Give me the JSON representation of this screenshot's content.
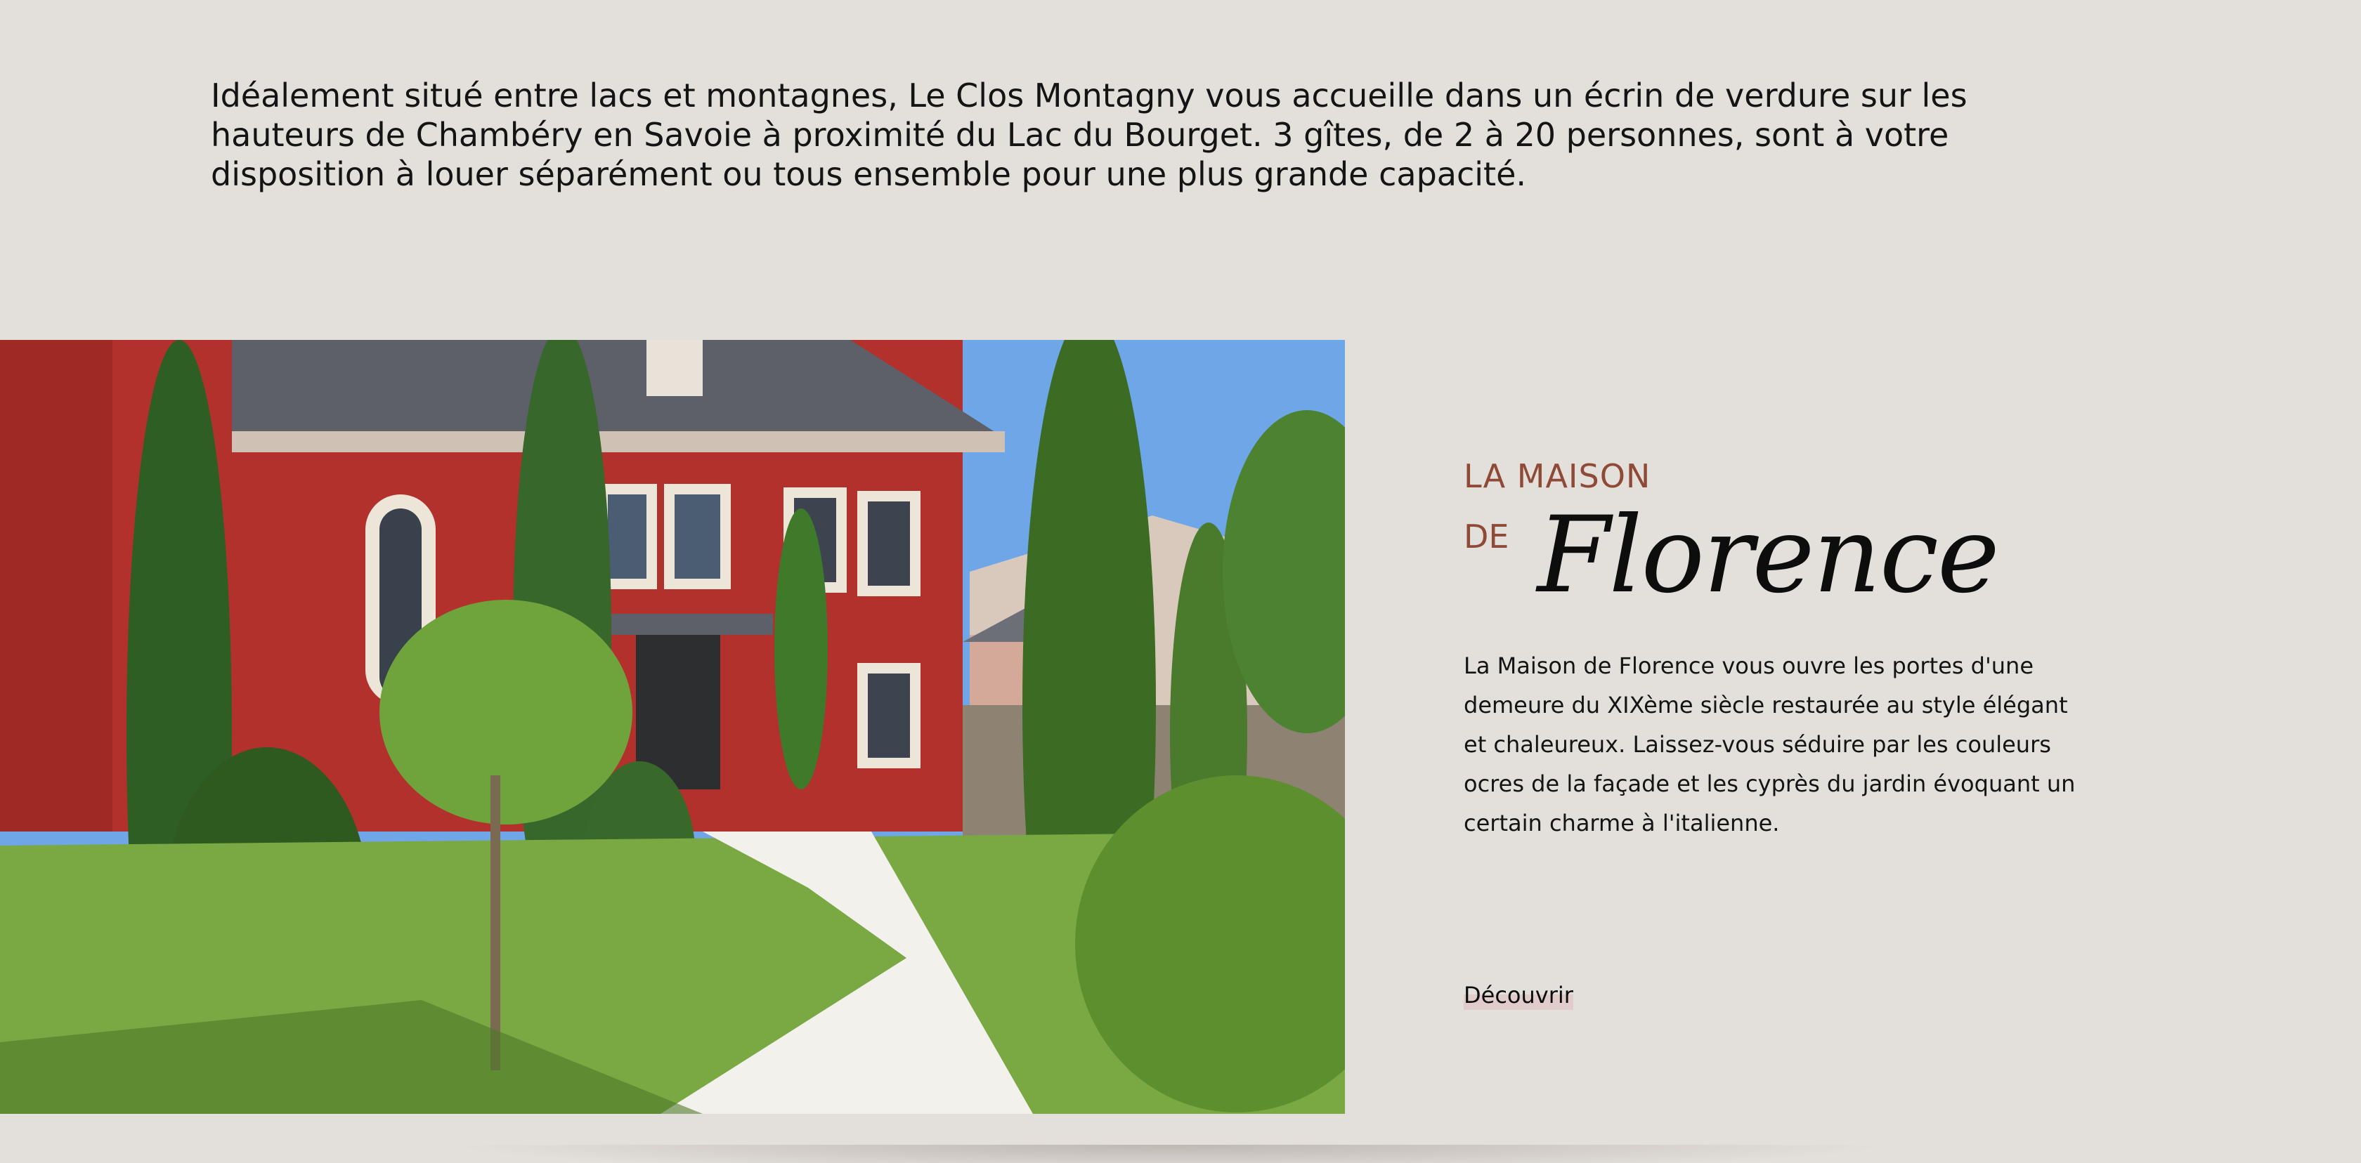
{
  "intro": {
    "text": "Idéalement situé entre lacs et montagnes, Le Clos Montagny vous accueille dans un écrin de verdure sur les hauteurs de Chambéry en Savoie à proximité du Lac du Bourget. 3 gîtes, de 2 à 20 personnes, sont à votre disposition à louer séparément ou tous ensemble pour une plus grande capacité."
  },
  "feature": {
    "eyebrow": "LA MAISON",
    "title_prefix": "DE",
    "title_script": "Florence",
    "description": "La Maison de Florence vous ouvre les portes d'une demeure du XIXème siècle restaurée au style élégant et chaleureux. Laissez-vous séduire par les couleurs ocres de la façade et les cyprès du jardin évoquant un certain charme à l'italienne.",
    "cta_label": "Découvrir",
    "accent_color": "#8f4a37"
  },
  "colors": {
    "background": "#e3dfdb",
    "text": "#141414"
  }
}
